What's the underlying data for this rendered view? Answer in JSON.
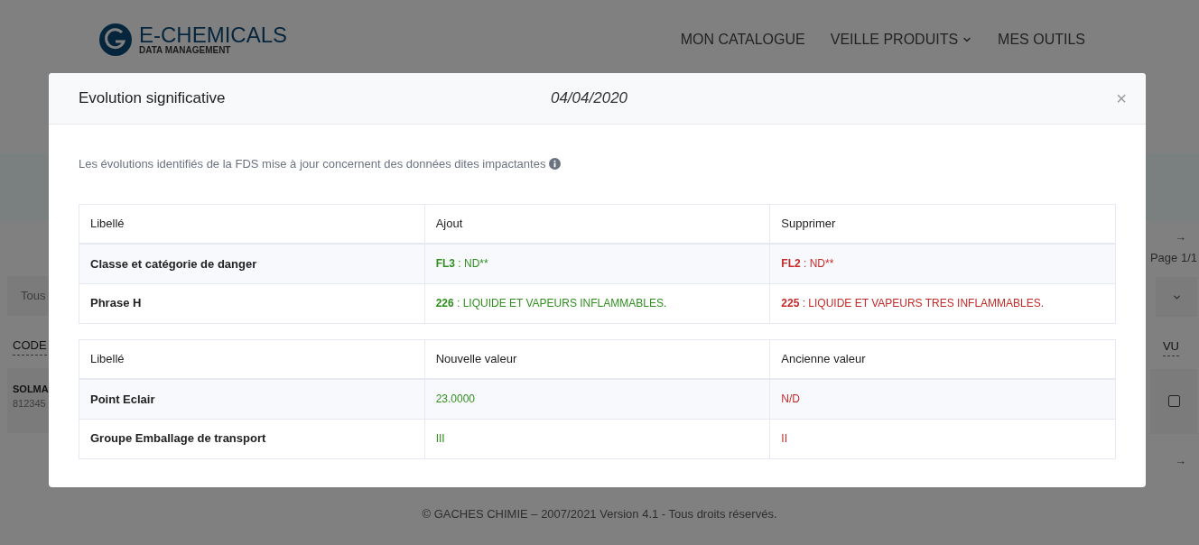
{
  "logo": {
    "name": "E-CHEMICALS",
    "tagline": "DATA MANAGEMENT"
  },
  "nav": [
    {
      "label": "MON CATALOGUE",
      "dropdown": false
    },
    {
      "label": "VEILLE PRODUITS",
      "dropdown": true
    },
    {
      "label": "MES OUTILS",
      "dropdown": false
    }
  ],
  "pagination": {
    "top_arrow": "→",
    "page": "Page 1/1",
    "bottom_arrow": "→"
  },
  "filter": {
    "value": "Tous"
  },
  "list": {
    "columns": [
      "CODE",
      "VU"
    ],
    "rows": [
      {
        "name": "SOLMA",
        "code": "812345",
        "checked": false
      }
    ]
  },
  "footer": "© GACHES CHIMIE – 2007/2021 Version 4.1 - Tous droits réservés.",
  "modal": {
    "title": "Evolution significative",
    "date": "04/04/2020",
    "close": "×",
    "intro": "Les évolutions identifiés de la FDS mise à jour concernent des données dites impactantes",
    "tables": [
      {
        "columns": [
          "Libellé",
          "Ajout",
          "Supprimer"
        ],
        "rows": [
          {
            "cells": [
              {
                "kind": "label",
                "text": "Classe et catégorie de danger"
              },
              {
                "kind": "added",
                "code": "FL3",
                "text": " : ND**"
              },
              {
                "kind": "removed",
                "code": "FL2",
                "text": " : ND**"
              }
            ]
          },
          {
            "cells": [
              {
                "kind": "label",
                "text": "Phrase H"
              },
              {
                "kind": "added",
                "code": "226",
                "text": " : LIQUIDE ET VAPEURS INFLAMMABLES."
              },
              {
                "kind": "removed",
                "code": "225",
                "text": " : LIQUIDE ET VAPEURS TRES INFLAMMABLES."
              }
            ]
          }
        ]
      },
      {
        "columns": [
          "Libellé",
          "Nouvelle valeur",
          "Ancienne valeur"
        ],
        "rows": [
          {
            "cells": [
              {
                "kind": "label",
                "text": "Point Eclair"
              },
              {
                "kind": "added",
                "text": "23.0000"
              },
              {
                "kind": "removed",
                "text": "N/D"
              }
            ]
          },
          {
            "cells": [
              {
                "kind": "label",
                "text": "Groupe Emballage de transport"
              },
              {
                "kind": "added",
                "text": "III"
              },
              {
                "kind": "removed",
                "text": "II"
              }
            ]
          }
        ]
      }
    ]
  }
}
